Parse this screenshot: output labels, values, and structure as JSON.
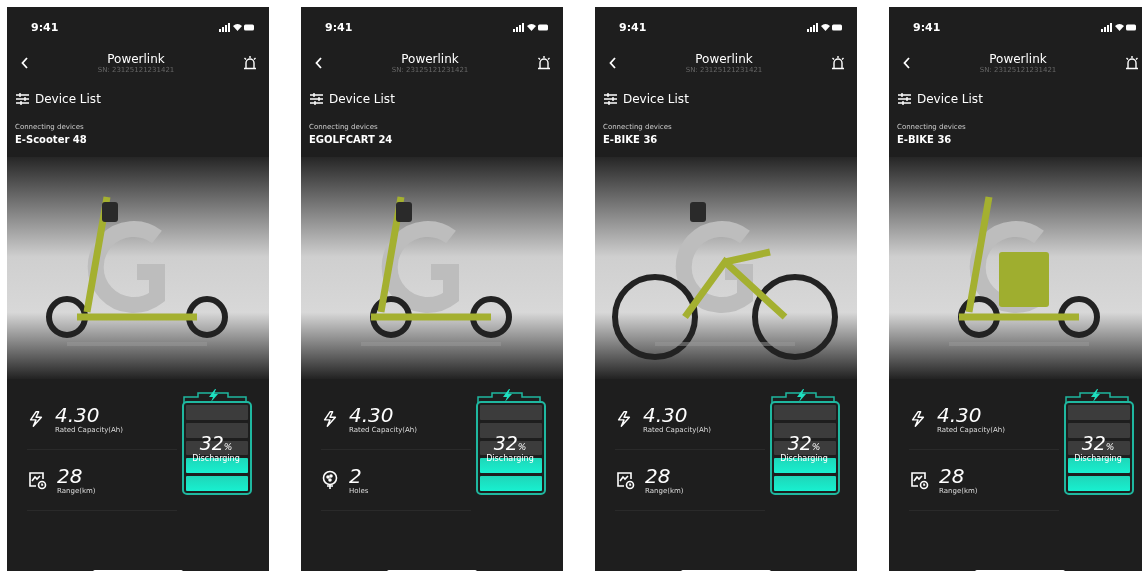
{
  "phones": [
    {
      "status_bar": {
        "time": "9:41"
      },
      "header": {
        "title": "Powerlink",
        "serial": "SN: 23125121231421"
      },
      "device_list": {
        "label": "Device List"
      },
      "connection": {
        "label": "Connecting devices",
        "device": "E-Scooter 48"
      },
      "stats": [
        {
          "kind": "capacity",
          "value": "4.30",
          "label": "Rated Capacity(Ah)"
        },
        {
          "kind": "range",
          "value": "28",
          "label": "Range(km)"
        }
      ],
      "battery": {
        "level": 0.32,
        "percent": "32",
        "unit": "%",
        "status": "Discharging"
      }
    },
    {
      "status_bar": {
        "time": "9:41"
      },
      "header": {
        "title": "Powerlink",
        "serial": "SN: 23125121231421"
      },
      "device_list": {
        "label": "Device List"
      },
      "connection": {
        "label": "Connecting devices",
        "device": "EGOLFCART 24"
      },
      "stats": [
        {
          "kind": "capacity",
          "value": "4.30",
          "label": "Rated Capacity(Ah)"
        },
        {
          "kind": "holes",
          "value": "2",
          "label": "Holes"
        }
      ],
      "battery": {
        "level": 0.32,
        "percent": "32",
        "unit": "%",
        "status": "Discharging"
      }
    },
    {
      "status_bar": {
        "time": "9:41"
      },
      "header": {
        "title": "Powerlink",
        "serial": "SN: 23125121231421"
      },
      "device_list": {
        "label": "Device List"
      },
      "connection": {
        "label": "Connecting devices",
        "device": "E-BIKE 36"
      },
      "stats": [
        {
          "kind": "capacity",
          "value": "4.30",
          "label": "Rated Capacity(Ah)"
        },
        {
          "kind": "range",
          "value": "28",
          "label": "Range(km)"
        }
      ],
      "battery": {
        "level": 0.32,
        "percent": "32",
        "unit": "%",
        "status": "Discharging"
      }
    },
    {
      "status_bar": {
        "time": "9:41"
      },
      "header": {
        "title": "Powerlink",
        "serial": "SN: 23125121231421"
      },
      "device_list": {
        "label": "Device List"
      },
      "connection": {
        "label": "Connecting devices",
        "device": "E-BIKE 36"
      },
      "stats": [
        {
          "kind": "capacity",
          "value": "4.30",
          "label": "Rated Capacity(Ah)"
        },
        {
          "kind": "range",
          "value": "28",
          "label": "Range(km)"
        }
      ],
      "battery": {
        "level": 0.32,
        "percent": "32",
        "unit": "%",
        "status": "Discharging"
      }
    }
  ]
}
